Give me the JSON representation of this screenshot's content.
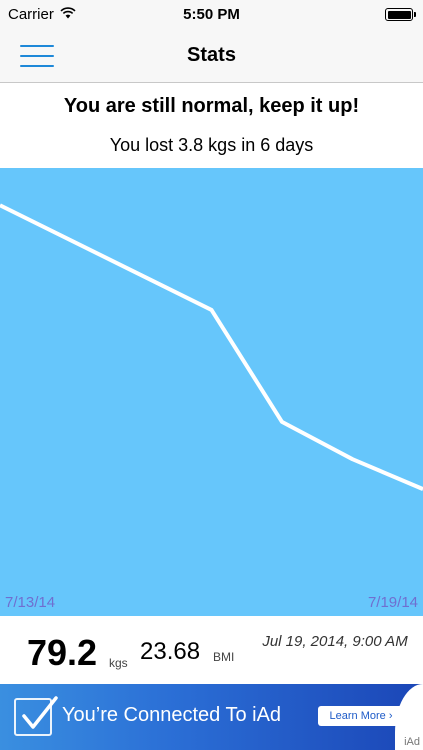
{
  "status_bar": {
    "carrier": "Carrier",
    "time": "5:50 PM",
    "wifi_icon": "wifi-icon",
    "battery_icon": "battery-icon",
    "battery_level": 1.0
  },
  "nav": {
    "title": "Stats",
    "menu_icon": "hamburger-menu-icon"
  },
  "summary": {
    "headline": "You are still normal, keep it up!",
    "subline": "You lost 3.8 kgs in 6 days"
  },
  "chart_data": {
    "type": "line",
    "x": [
      "7/13/14",
      "7/16/14",
      "7/17/14",
      "7/18/14",
      "7/19/14"
    ],
    "series": [
      {
        "values": [
          83.0,
          81.6,
          80.1,
          79.6,
          79.2
        ]
      }
    ],
    "tick_labels": [
      "7/13/14",
      "7/19/14"
    ],
    "ylim": [
      77.5,
      83.5
    ],
    "background_color": "#66c6fb",
    "line_color": "#ffffff",
    "tick_color": "#6f6fd0",
    "grid": false
  },
  "stats": {
    "weight": "79.2",
    "weight_unit": "kgs",
    "bmi": "23.68",
    "bmi_unit": "BMI",
    "timestamp": "Jul 19, 2014, 9:00 AM"
  },
  "ad": {
    "text": "You’re Connected To iAd",
    "button": "Learn More ",
    "brand": "iAd",
    "check_icon": "checkmark-icon"
  },
  "colors": {
    "accent": "#1e88d8",
    "chart_background": "#66c6fb",
    "ad_gradient_start": "#3a8fe0",
    "ad_gradient_end": "#1b46b7"
  }
}
